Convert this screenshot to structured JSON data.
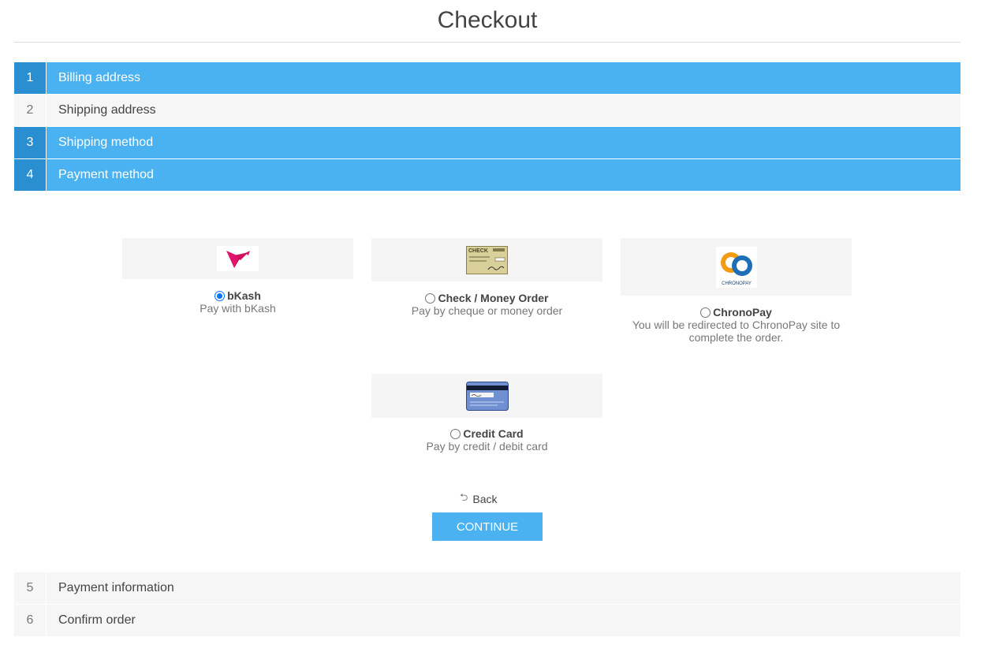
{
  "page": {
    "title": "Checkout"
  },
  "steps": [
    {
      "number": "1",
      "label": "Billing address",
      "state": "active"
    },
    {
      "number": "2",
      "label": "Shipping address",
      "state": "inactive"
    },
    {
      "number": "3",
      "label": "Shipping method",
      "state": "active"
    },
    {
      "number": "4",
      "label": "Payment method",
      "state": "active"
    },
    {
      "number": "5",
      "label": "Payment information",
      "state": "inactive"
    },
    {
      "number": "6",
      "label": "Confirm order",
      "state": "inactive"
    }
  ],
  "payment_methods": [
    {
      "name": "bKash",
      "description": "Pay with bKash",
      "selected": true,
      "icon": "bkash-logo"
    },
    {
      "name": "Check / Money Order",
      "description": "Pay by cheque or money order",
      "selected": false,
      "icon": "check-logo"
    },
    {
      "name": "ChronoPay",
      "description": "You will be redirected to ChronoPay site to complete the order.",
      "selected": false,
      "icon": "chronopay-logo"
    },
    {
      "name": "Credit Card",
      "description": "Pay by credit / debit card",
      "selected": false,
      "icon": "credit-card-logo"
    }
  ],
  "logo_text": {
    "check": "CHECK",
    "chronopay": "CHRONOPAY"
  },
  "actions": {
    "back_label": "Back",
    "continue_label": "CONTINUE"
  },
  "colors": {
    "accent": "#4ab2f1",
    "accent_dark": "#2a8fd0",
    "inactive_bg": "#f6f6f6"
  }
}
